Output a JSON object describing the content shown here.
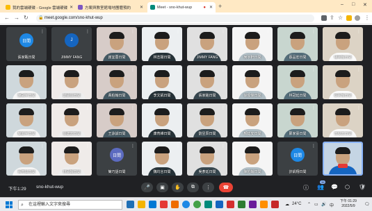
{
  "browser": {
    "tabs": [
      {
        "title": "我的雲端硬碟 - Google 雲端硬碟",
        "active": false,
        "favicon_color": "#fbbc04"
      },
      {
        "title": "方案與教室館場地團體預約",
        "active": false,
        "favicon_color": "#7e57c2"
      },
      {
        "title": "Meet - sno-khut-wup",
        "active": true,
        "favicon_color": "#00897b",
        "recording": true
      }
    ],
    "new_tab": "+",
    "url": "meet.google.com/sno-khut-wup",
    "window_controls": [
      "–",
      "□",
      "✕"
    ]
  },
  "meet": {
    "participants": [
      {
        "name": "張家甄日間",
        "type": "avatar",
        "avatar_text": "日間",
        "avatar_color": "#1e88e5"
      },
      {
        "name": "JIMMY FANG",
        "type": "avatar",
        "avatar_text": "J",
        "avatar_color": "#1565c0"
      },
      {
        "name": "謝宜蓉日間",
        "type": "video"
      },
      {
        "name": "林志揚日間",
        "type": "video"
      },
      {
        "name": "JIMMY FANG",
        "type": "video"
      },
      {
        "name": "吳宇軒日間",
        "type": "video"
      },
      {
        "name": "蔡品宏日間",
        "type": "video"
      },
      {
        "name": "楊明翰日間",
        "type": "video"
      },
      {
        "name": "陳冠宇日間",
        "type": "video"
      },
      {
        "name": "劉承恩日間",
        "type": "video"
      },
      {
        "name": "黃柏翰日間",
        "type": "video"
      },
      {
        "name": "李文凱日間",
        "type": "video"
      },
      {
        "name": "張家銘日間",
        "type": "video"
      },
      {
        "name": "徐俊傑日間",
        "type": "video"
      },
      {
        "name": "林冠廷日間",
        "type": "video"
      },
      {
        "name": "蔡宗翰日間",
        "type": "video"
      },
      {
        "name": "簡庭宇日間",
        "type": "video"
      },
      {
        "name": "周建宏日間",
        "type": "video"
      },
      {
        "name": "王詠誠日間",
        "type": "video"
      },
      {
        "name": "康育維日間",
        "type": "video"
      },
      {
        "name": "劉昱辰日間",
        "type": "video"
      },
      {
        "name": "顏廷安日間",
        "type": "video"
      },
      {
        "name": "鄭家豪日間",
        "type": "video"
      },
      {
        "name": "曾俊宏日間",
        "type": "video"
      },
      {
        "name": "張育誠日間",
        "type": "video"
      },
      {
        "name": "林承翰日間",
        "type": "video"
      },
      {
        "name": "簡巧語日間",
        "type": "avatar",
        "avatar_text": "日間",
        "avatar_color": "#5c6bc0"
      },
      {
        "name": "魏均言日間",
        "type": "video"
      },
      {
        "name": "吳彥廷日間",
        "type": "video"
      },
      {
        "name": "陳柏翰日間",
        "type": "video"
      },
      {
        "name": "許凱翔日間",
        "type": "avatar",
        "avatar_text": "日間",
        "avatar_color": "#1e88e5"
      },
      {
        "name": "",
        "type": "self"
      }
    ],
    "meeting_time": "下午1:29",
    "meeting_code": "sno-khut-wup",
    "people_count": "35"
  },
  "taskbar": {
    "search_placeholder": "在這裡輸入文字來搜尋",
    "weather": "24°C",
    "clock_time": "下午 01:29",
    "clock_date": "2022/5/9"
  }
}
